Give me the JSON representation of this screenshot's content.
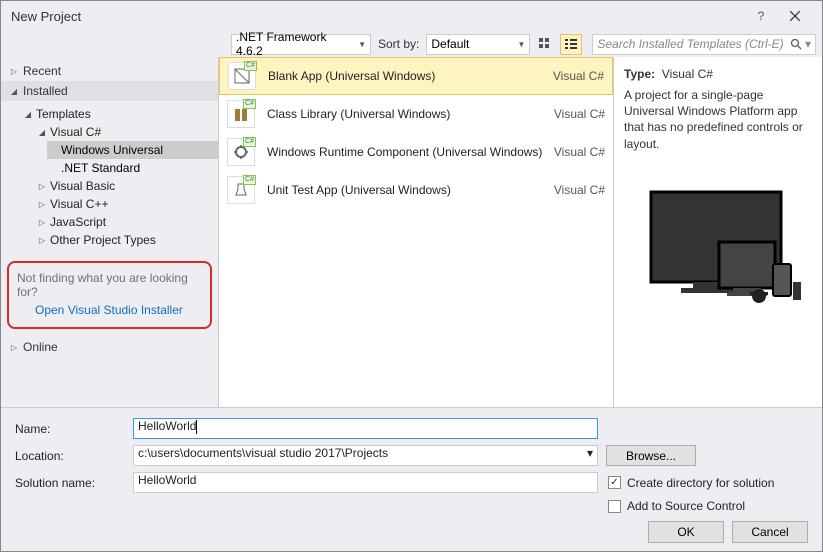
{
  "title": "New Project",
  "toolbar": {
    "framework": ".NET Framework 4.6.2",
    "sortby_label": "Sort by:",
    "sortby_value": "Default",
    "search_placeholder": "Search Installed Templates (Ctrl-E)"
  },
  "sidebar": {
    "recent": "Recent",
    "installed": "Installed",
    "online": "Online",
    "templates": "Templates",
    "csharp": "Visual C#",
    "windows_universal": "Windows Universal",
    "net_standard": ".NET Standard",
    "vb": "Visual Basic",
    "cpp": "Visual C++",
    "js": "JavaScript",
    "other": "Other Project Types",
    "not_finding": "Not finding what you are looking for?",
    "open_installer": "Open Visual Studio Installer"
  },
  "templates": [
    {
      "name": "Blank App (Universal Windows)",
      "lang": "Visual C#"
    },
    {
      "name": "Class Library (Universal Windows)",
      "lang": "Visual C#"
    },
    {
      "name": "Windows Runtime Component (Universal Windows)",
      "lang": "Visual C#"
    },
    {
      "name": "Unit Test App (Universal Windows)",
      "lang": "Visual C#"
    }
  ],
  "details": {
    "type_label": "Type:",
    "type_value": "Visual C#",
    "description": "A project for a single-page Universal Windows Platform app that has no predefined controls or layout."
  },
  "form": {
    "name_label": "Name:",
    "name_value": "HelloWorld",
    "location_label": "Location:",
    "location_value": "c:\\users\\documents\\visual studio 2017\\Projects",
    "solution_label": "Solution name:",
    "solution_value": "HelloWorld",
    "browse": "Browse...",
    "create_dir": "Create directory for solution",
    "add_sc": "Add to Source Control",
    "ok": "OK",
    "cancel": "Cancel"
  }
}
